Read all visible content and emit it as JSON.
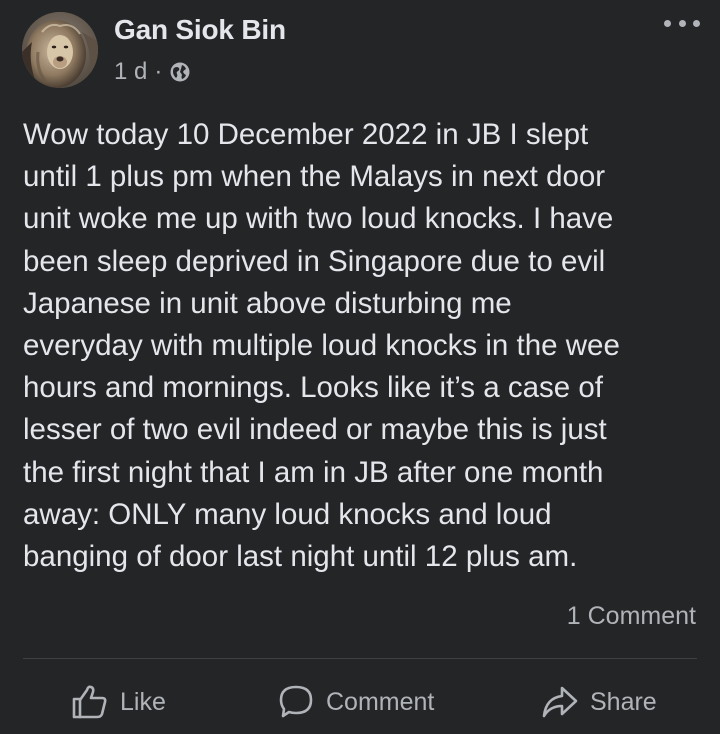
{
  "post": {
    "author": "Gan Siok Bin",
    "timestamp": "1 d",
    "separator": "·",
    "privacy_icon": "globe-icon",
    "more_icon": "more-options-icon",
    "body_lines": [
      "Wow today 10 December 2022 in JB I slept",
      "until 1 plus pm when the Malays in next door",
      "unit woke me up with two loud knocks. I have",
      "been sleep deprived in Singapore due to evil",
      "Japanese in unit above disturbing me",
      "everyday with multiple loud knocks in the wee",
      "hours and mornings. Looks like it’s a case of",
      "lesser of two evil indeed or maybe this is just",
      "the first night that I am in JB after one month",
      "away: ONLY many loud knocks and loud",
      "banging of door last night until 12 plus am."
    ],
    "comment_count": "1 Comment"
  },
  "actions": {
    "like_label": "Like",
    "comment_label": "Comment",
    "share_label": "Share"
  },
  "colors": {
    "background": "#242526",
    "primary_text": "#e4e6eb",
    "secondary_text": "#b0b3b8",
    "divider": "#3e4042"
  }
}
